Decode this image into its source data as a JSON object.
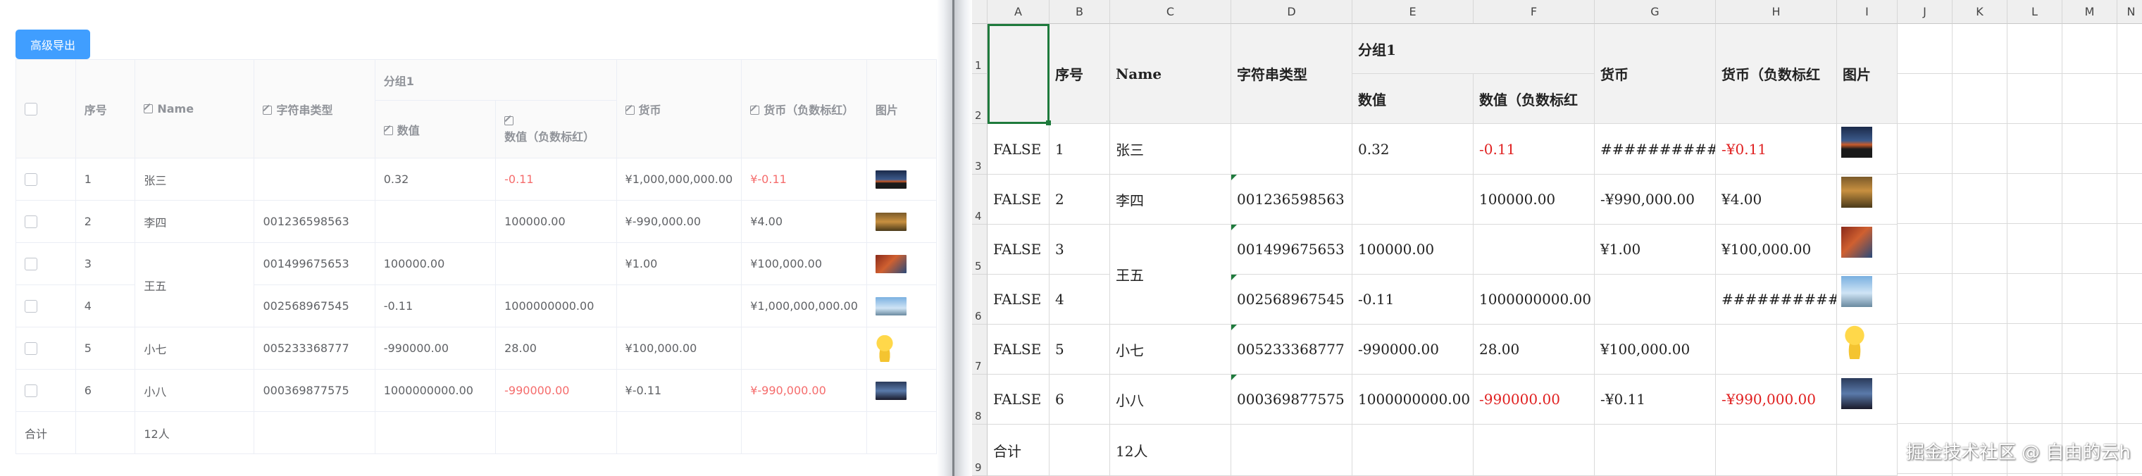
{
  "left_panel": {
    "export_button": "高级导出",
    "headers": {
      "index": "序号",
      "name": "Name",
      "string_type": "字符串类型",
      "group1": "分组1",
      "number": "数值",
      "number_neg_red": "数值（负数标红）",
      "currency": "货币",
      "currency_neg_red": "货币（负数标红）",
      "image": "图片"
    },
    "rows": [
      {
        "idx": "1",
        "name": "张三",
        "str": "",
        "num": "0.32",
        "num_red": "-0.11",
        "cur": "¥1,000,000,000.00",
        "cur_red": "¥-0.11"
      },
      {
        "idx": "2",
        "name": "李四",
        "str": "001236598563",
        "num": "",
        "num_red": "100000.00",
        "cur": "¥-990,000.00",
        "cur_red": "¥4.00"
      },
      {
        "idx": "3",
        "name": "王五",
        "str": "001499675653",
        "num": "100000.00",
        "num_red": "",
        "cur": "¥1.00",
        "cur_red": "¥100,000.00"
      },
      {
        "idx": "4",
        "name": "",
        "str": "002568967545",
        "num": "-0.11",
        "num_red": "1000000000.00",
        "cur": "",
        "cur_red": "¥1,000,000,000.00"
      },
      {
        "idx": "5",
        "name": "小七",
        "str": "005233368777",
        "num": "-990000.00",
        "num_red": "28.00",
        "cur": "¥100,000.00",
        "cur_red": ""
      },
      {
        "idx": "6",
        "name": "小八",
        "str": "000369877575",
        "num": "1000000000.00",
        "num_red": "-990000.00",
        "cur": "¥-0.11",
        "cur_red": "¥-990,000.00"
      }
    ],
    "footer": {
      "label": "合计",
      "count": "12人"
    }
  },
  "spreadsheet": {
    "columns": [
      "A",
      "B",
      "C",
      "D",
      "E",
      "F",
      "G",
      "H",
      "I",
      "J",
      "K",
      "L",
      "M",
      "N"
    ],
    "rows": [
      "1",
      "2",
      "3",
      "4",
      "5",
      "6",
      "7",
      "8",
      "9"
    ],
    "header": {
      "index": "序号",
      "name": "Name",
      "string_type": "字符串类型",
      "group1": "分组1",
      "number": "数值",
      "number_neg_red": "数值（负数标红",
      "currency": "货币",
      "currency_neg_red": "货币（负数标红",
      "image": "图片"
    },
    "data": [
      {
        "a": "FALSE",
        "b": "1",
        "c": "张三",
        "d": "",
        "e": "0.32",
        "f": "-0.11",
        "g": "##############",
        "h": "-¥0.11"
      },
      {
        "a": "FALSE",
        "b": "2",
        "c": "李四",
        "d": "001236598563",
        "e": "",
        "f": "100000.00",
        "g": "-¥990,000.00",
        "h": "¥4.00"
      },
      {
        "a": "FALSE",
        "b": "3",
        "c": "王五",
        "d": "001499675653",
        "e": "100000.00",
        "f": "",
        "g": "¥1.00",
        "h": "¥100,000.00"
      },
      {
        "a": "FALSE",
        "b": "4",
        "c": "",
        "d": "002568967545",
        "e": "-0.11",
        "f": "1000000000.00",
        "g": "",
        "h": "##############"
      },
      {
        "a": "FALSE",
        "b": "5",
        "c": "小七",
        "d": "005233368777",
        "e": "-990000.00",
        "f": "28.00",
        "g": "¥100,000.00",
        "h": ""
      },
      {
        "a": "FALSE",
        "b": "6",
        "c": "小八",
        "d": "000369877575",
        "e": "1000000000.00",
        "f": "-990000.00",
        "g": "-¥0.11",
        "h": "-¥990,000.00"
      }
    ],
    "footer": {
      "label": "合计",
      "count": "12人"
    },
    "watermark": "掘金技术社区 @ 自由的云h"
  }
}
